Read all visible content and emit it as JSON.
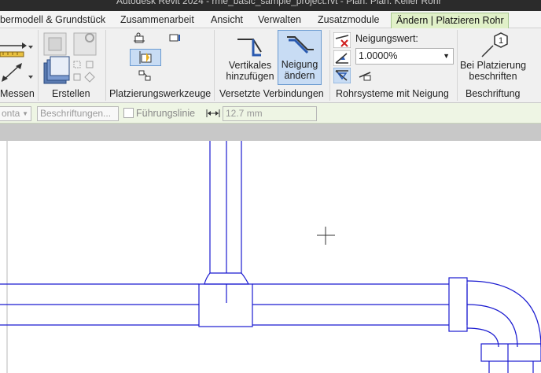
{
  "title_fragment": "Autodesk Revit 2024 - rme_basic_sample_project.rvt - Plan: Plan: Keller Rohr",
  "tabs": [
    {
      "label": "bermodell & Grundstück"
    },
    {
      "label": "Zusammenarbeit"
    },
    {
      "label": "Ansicht"
    },
    {
      "label": "Verwalten"
    },
    {
      "label": "Zusatzmodule"
    },
    {
      "label": "Ändern | Platzieren Rohr"
    }
  ],
  "panels": {
    "messen": "Messen",
    "erstellen": "Erstellen",
    "platzierungswerkzeuge": "Platzierungswerkzeuge",
    "versetzte_verbindungen": "Versetzte Verbindungen",
    "rohrsysteme": "Rohrsysteme mit Neigung",
    "beschriftung": "Beschriftung"
  },
  "buttons": {
    "vertikales_l1": "Vertikales",
    "vertikales_l2": "hinzufügen",
    "neigung_l1": "Neigung",
    "neigung_l2": "ändern",
    "bei_platzierung_l1": "Bei Platzierung",
    "bei_platzierung_l2": "beschriften",
    "tag_number": "1"
  },
  "neigungswert": {
    "label": "Neigungswert:",
    "value": "1.0000%"
  },
  "options": {
    "orientation_value": "onta",
    "beschriftungen_placeholder": "Beschriftungen...",
    "fuehrungslinie_label": "Führungslinie",
    "length_value": "12.7 mm"
  },
  "colors": {
    "pipe_line": "#1a1ad0",
    "context_tab": "#e0f0c8",
    "active_button": "#c8dcf4"
  }
}
